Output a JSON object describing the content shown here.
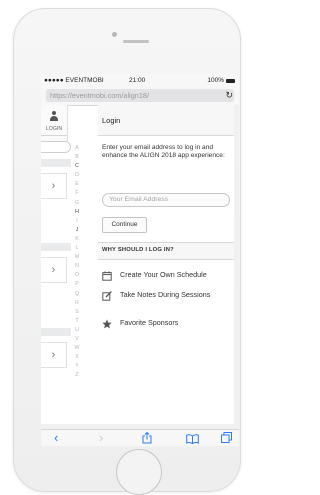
{
  "status": {
    "carrier": "●●●●● EVENTMOBI",
    "time": "21:00",
    "battery": "100%"
  },
  "browser": {
    "url": "https://eventmobi.com/align18/",
    "reload_icon": "reload-icon"
  },
  "sidebar": {
    "login_label": "LOGIN",
    "alphabet": [
      "A",
      "B",
      "C",
      "D",
      "E",
      "F",
      "G",
      "H",
      "I",
      "J",
      "K",
      "L",
      "M",
      "N",
      "O",
      "P",
      "Q",
      "R",
      "S",
      "T",
      "U",
      "V",
      "W",
      "X",
      "Y",
      "Z"
    ]
  },
  "login": {
    "title": "Login",
    "intro": "Enter your email address to log in and enhance the ALIGN 2018 app experience:",
    "email_placeholder": "Your Email Address",
    "continue_label": "Continue",
    "why_header": "WHY SHOULD I LOG IN?",
    "features": [
      {
        "icon": "calendar-icon",
        "label": "Create Your Own Schedule"
      },
      {
        "icon": "pencil-note-icon",
        "label": "Take Notes During Sessions"
      },
      {
        "icon": "star-icon",
        "label": "Favorite Sponsors"
      }
    ]
  },
  "toolbar": {
    "back": "‹",
    "forward": "›"
  },
  "colors": {
    "accent": "#2a7bf6",
    "icon_gray": "#555555"
  }
}
